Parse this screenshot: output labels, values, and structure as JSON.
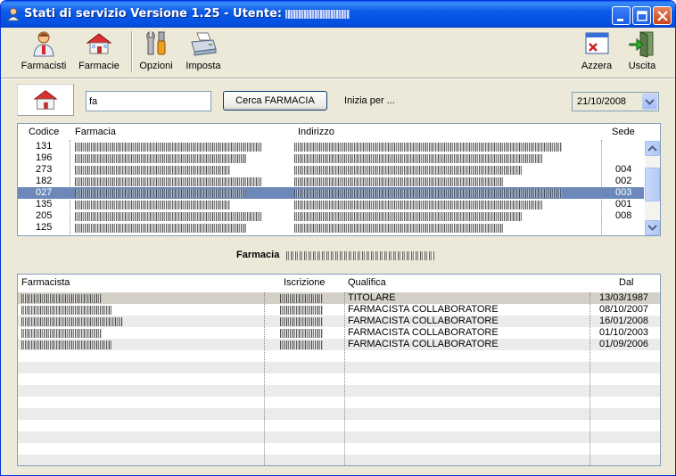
{
  "window": {
    "title": "Stati di servizio Versione 1.25 - Utente:",
    "colors": {
      "titlebar": "#0a5ae9",
      "face": "#ece9d8",
      "selection": "#6c88b8"
    }
  },
  "toolbar": {
    "items": [
      {
        "label": "Farmacisti",
        "icon": "pharmacist-icon"
      },
      {
        "label": "Farmacie",
        "icon": "pharmacy-house-icon"
      },
      {
        "label": "Opzioni",
        "icon": "tools-icon"
      },
      {
        "label": "Imposta",
        "icon": "printer-icon"
      },
      {
        "label": "Azzera",
        "icon": "reset-window-icon"
      },
      {
        "label": "Uscita",
        "icon": "exit-door-icon"
      }
    ]
  },
  "search": {
    "value": "fa",
    "button_label": "Cerca FARMACIA",
    "hint": "Inizia per ...",
    "date": "21/10/2008"
  },
  "pharmacies": {
    "columns": [
      "Codice",
      "Farmacia",
      "Indirizzo",
      "Sede"
    ],
    "rows": [
      {
        "codice": "131",
        "sede": "",
        "selected": false
      },
      {
        "codice": "196",
        "sede": "",
        "selected": false
      },
      {
        "codice": "273",
        "sede": "004",
        "selected": false
      },
      {
        "codice": "182",
        "sede": "002",
        "selected": false
      },
      {
        "codice": "027",
        "sede": "003",
        "selected": true
      },
      {
        "codice": "135",
        "sede": "001",
        "selected": false
      },
      {
        "codice": "205",
        "sede": "008",
        "selected": false
      },
      {
        "codice": "125",
        "sede": "",
        "selected": false
      }
    ]
  },
  "detail": {
    "title": "Farmacia"
  },
  "pharmacists": {
    "columns": [
      "Farmacista",
      "Iscrizione",
      "Qualifica",
      "Dal"
    ],
    "rows": [
      {
        "qualifica": "TITOLARE",
        "dal": "13/03/1987"
      },
      {
        "qualifica": "FARMACISTA COLLABORATORE",
        "dal": "08/10/2007"
      },
      {
        "qualifica": "FARMACISTA COLLABORATORE",
        "dal": "16/01/2008"
      },
      {
        "qualifica": "FARMACISTA COLLABORATORE",
        "dal": "01/10/2003"
      },
      {
        "qualifica": "FARMACISTA COLLABORATORE",
        "dal": "01/09/2006"
      }
    ]
  }
}
